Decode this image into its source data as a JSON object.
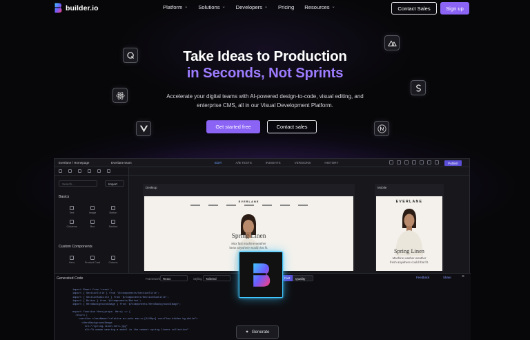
{
  "brand": {
    "name": "builder.io"
  },
  "nav": {
    "links": [
      {
        "label": "Platform",
        "has_dropdown": true
      },
      {
        "label": "Solutions",
        "has_dropdown": true
      },
      {
        "label": "Developers",
        "has_dropdown": true
      },
      {
        "label": "Pricing",
        "has_dropdown": false
      },
      {
        "label": "Resources",
        "has_dropdown": true
      }
    ],
    "chevron": "⌄",
    "contact_sales": "Contact Sales",
    "sign_up": "Sign up"
  },
  "hero": {
    "title_line1": "Take Ideas to Production",
    "title_line2": "in Seconds, Not Sprints",
    "subtitle": "Accelerate your digital teams with AI-powered design-to-code, visual editing, and enterprise CMS, all in our Visual Development Platform.",
    "cta_primary": "Get started free",
    "cta_secondary": "Contact sales"
  },
  "floating_icons": [
    "qwik-icon",
    "react-icon",
    "vue-icon",
    "nuxt-icon",
    "svelte-icon",
    "nextjs-icon"
  ],
  "app": {
    "breadcrumb": "Everlane / Homepage",
    "team": "Everlane team",
    "tabs": [
      "EDIT",
      "A/B TESTS",
      "INSIGHTS",
      "VERSIONS",
      "HISTORY"
    ],
    "publish": "Publish",
    "left_panel": {
      "search_placeholder": "Search...",
      "import": "Import",
      "basics_title": "Basics",
      "basics": [
        "Text",
        "Image",
        "Button",
        "Columns",
        "Box",
        "Section"
      ],
      "custom_title": "Custom Components",
      "custom": [
        "Hero",
        "Product Card",
        "Column"
      ]
    },
    "desktop_label": "Desktop",
    "mobile_label": "Mobile",
    "site": {
      "logo": "EVERLANE",
      "headline": "Spring Linen",
      "desktop_sub": "Max fast machine weather\nbean anywhere would that fit.",
      "mobile_sub": "Machine washer weather\nfresh anywhere could that fit."
    },
    "code_panel": {
      "title": "Generated Code",
      "framework_label": "Framework",
      "framework": "React",
      "styling_label": "Styling",
      "styling": "Tailwind",
      "mode_fast": "Fast",
      "mode_quality": "Quality",
      "feedback": "Feedback",
      "share": "Share",
      "close": "×",
      "generate": "Generate",
      "code_lines": [
        "import React from 'react';",
        "import { SectionTitle } from '@/components/SectionTitle';",
        "import { SectionSubtitle } from '@/components/SectionSubtitle';",
        "import { Button } from '@/components/Button';",
        "import { HeroBackgroundImage } from '@/components/HeroBackgroundImage';",
        "",
        "export function Hero(props: Hero) => {",
        "  return (",
        "    <section className=\"relative mx-auto max-w-[1440px] overflow-hidden bg-white\">",
        "      <HeroBackgroundImage",
        "        src=\"/spring-linen-hero.jpg\"",
        "        alt=\"A woman wearing a model in the newest spring linens collection\""
      ]
    }
  }
}
